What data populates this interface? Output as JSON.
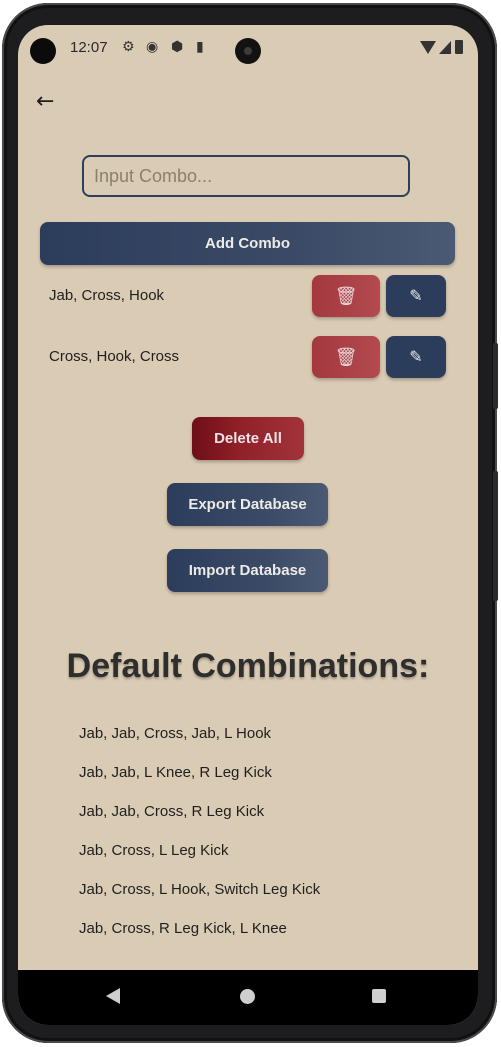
{
  "status_bar": {
    "time": "12:07",
    "icons": [
      "settings-icon",
      "app-icon",
      "shield-icon",
      "sd-card-icon",
      "wifi-icon",
      "cellular-icon",
      "battery-icon"
    ]
  },
  "nav": {
    "back_icon": "arrow-left-icon"
  },
  "combo_input": {
    "placeholder": "Input Combo...",
    "value": ""
  },
  "add_button": {
    "label": "Add Combo"
  },
  "combos": [
    {
      "text": "Jab, Cross, Hook",
      "delete_icon": "trash-icon",
      "edit_icon": "pencil-icon"
    },
    {
      "text": "Cross, Hook, Cross",
      "delete_icon": "trash-icon",
      "edit_icon": "pencil-icon"
    }
  ],
  "actions": {
    "delete_all": "Delete All",
    "export_db": "Export Database",
    "import_db": "Import Database"
  },
  "defaults": {
    "heading": "Default Combinations:",
    "items": [
      "Jab, Jab, Cross, Jab, L Hook",
      "Jab, Jab, L Knee, R Leg Kick",
      "Jab, Jab, Cross, R Leg Kick",
      "Jab, Cross, L Leg Kick",
      "Jab, Cross, L Hook, Switch Leg Kick",
      "Jab, Cross, R Leg Kick, L Knee"
    ]
  },
  "colors": {
    "background": "#dacbb4",
    "navy": "#2c3d5c",
    "delete_red": "#a4383f",
    "delete_all_red": "#8f1f28"
  }
}
